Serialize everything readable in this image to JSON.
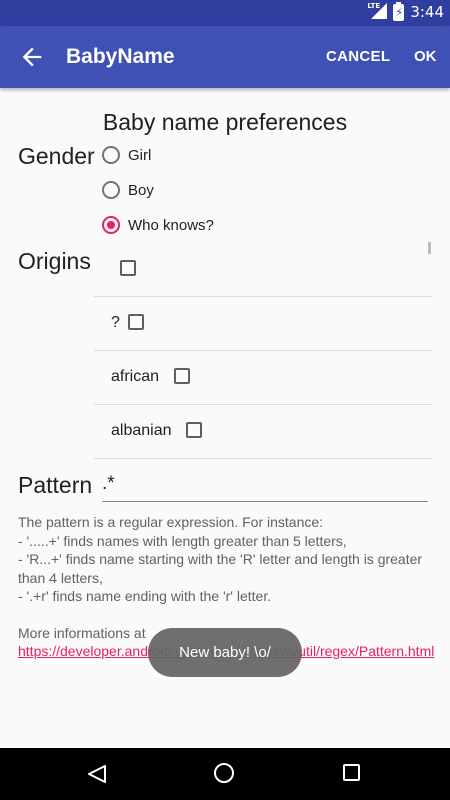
{
  "status_bar": {
    "network_label": "LTE",
    "battery_icon": "battery-charging-icon",
    "signal_icon": "signal-icon",
    "time": "3:44"
  },
  "app_bar": {
    "back_icon": "arrow-back-icon",
    "title": "BabyName",
    "cancel_label": "CANCEL",
    "ok_label": "OK",
    "background_color": "#3f51b5",
    "status_color": "#303f9f"
  },
  "form": {
    "heading": "Baby name preferences",
    "gender": {
      "label": "Gender",
      "options": [
        {
          "label": "Girl",
          "checked": false
        },
        {
          "label": "Boy",
          "checked": false
        },
        {
          "label": "Who knows?",
          "checked": true
        }
      ]
    },
    "origins": {
      "label": "Origins",
      "items": [
        {
          "label": "",
          "checked": false
        },
        {
          "label": "?",
          "checked": false
        },
        {
          "label": "african",
          "checked": false
        },
        {
          "label": "albanian",
          "checked": false
        }
      ]
    },
    "pattern": {
      "label": "Pattern",
      "value": ".*"
    },
    "help": {
      "line1": "The pattern is a regular expression. For instance:",
      "line2": " - '.....+' finds names with length greater than 5 letters,",
      "line3": " - 'R...+' finds name starting with the 'R' letter and length is greater than 4 letters,",
      "line4": " - '.+r' finds name ending with the 'r' letter.",
      "more_prefix": "More informations at ",
      "link_text": "https://developer.android.com/reference/java/util/regex/Pattern.html"
    }
  },
  "toast": {
    "text": "New baby! \\o/"
  },
  "accent_color": "#e91e63",
  "nav_bar": {
    "back_icon": "triangle-back-icon",
    "home_icon": "circle-home-icon",
    "recent_icon": "square-recents-icon"
  }
}
